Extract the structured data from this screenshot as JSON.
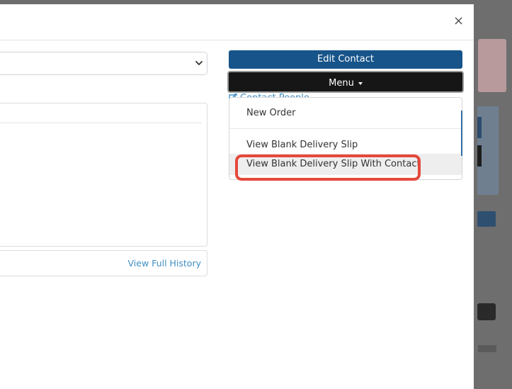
{
  "modal": {
    "close_label": "×"
  },
  "history": {
    "link_label": "View Full History"
  },
  "actions": {
    "edit_contact_label": "Edit Contact",
    "menu_label": "Menu",
    "contact_people_label": "Contact People"
  },
  "menu": {
    "items": [
      {
        "label": "New Order"
      },
      {
        "label": "View Blank Delivery Slip"
      },
      {
        "label": "View Blank Delivery Slip With Contact"
      }
    ],
    "highlighted_index": 2
  },
  "icons": {
    "close": "close-icon",
    "chevron": "chevron-down-icon",
    "caret": "caret-down-icon",
    "external_link": "external-link-icon"
  },
  "colors": {
    "primary": "#17548a",
    "dark_button": "#161616",
    "link": "#3f8ec4",
    "highlight_ring": "#e5483c"
  }
}
